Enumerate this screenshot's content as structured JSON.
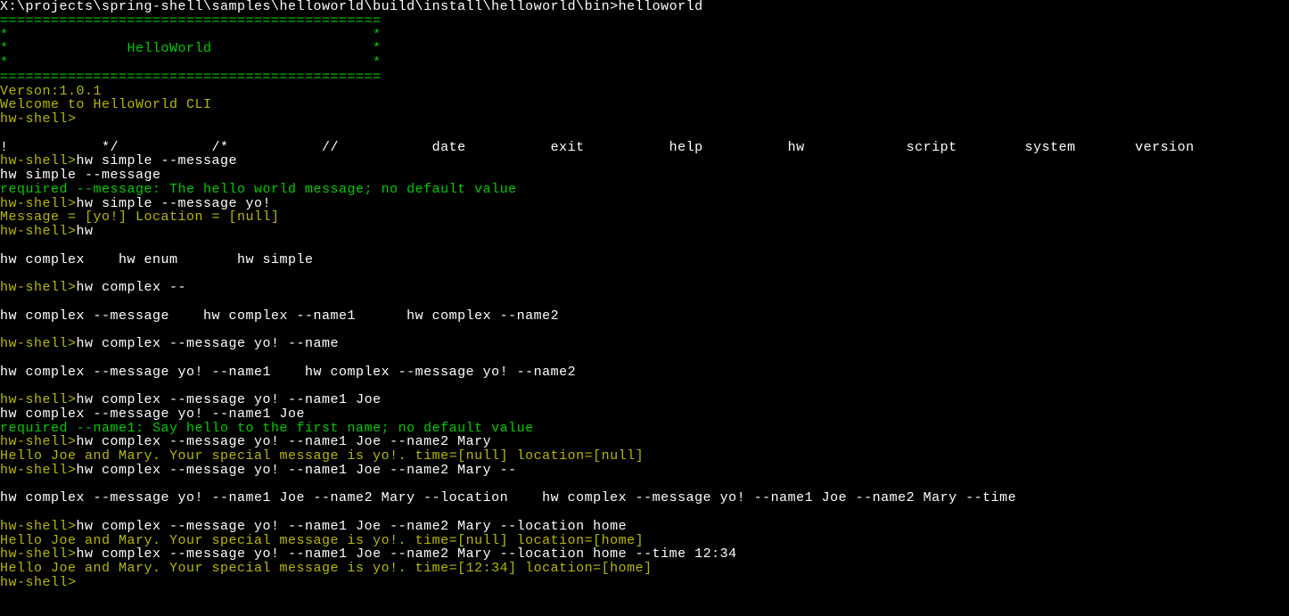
{
  "terminal": {
    "lines": [
      {
        "cls": "white",
        "text": "X:\\projects\\spring-shell\\samples\\helloworld\\build\\install\\helloworld\\bin>helloworld"
      },
      {
        "cls": "green",
        "text": "============================================="
      },
      {
        "cls": "green",
        "text": "*                                           *"
      },
      {
        "cls": "green",
        "text": "*              HelloWorld                   *"
      },
      {
        "cls": "green",
        "text": "*                                           *"
      },
      {
        "cls": "green",
        "text": "============================================="
      },
      {
        "cls": "yellow",
        "text": "Verson:1.0.1"
      },
      {
        "cls": "yellow",
        "text": "Welcome to HelloWorld CLI"
      },
      {
        "cls": "yellow",
        "text": "hw-shell>"
      },
      {
        "cls": "white",
        "text": ""
      },
      {
        "cls": "white",
        "text": "!           */           /*           //           date          exit          help          hw            script        system       version"
      },
      {
        "segments": [
          {
            "cls": "yellow",
            "text": "hw-shell>"
          },
          {
            "cls": "white",
            "text": "hw simple --message"
          }
        ]
      },
      {
        "cls": "white",
        "text": "hw simple --message"
      },
      {
        "cls": "green",
        "text": "required --message: The hello world message; no default value"
      },
      {
        "segments": [
          {
            "cls": "yellow",
            "text": "hw-shell>"
          },
          {
            "cls": "white",
            "text": "hw simple --message yo!"
          }
        ]
      },
      {
        "cls": "yellow",
        "text": "Message = [yo!] Location = [null]"
      },
      {
        "segments": [
          {
            "cls": "yellow",
            "text": "hw-shell>"
          },
          {
            "cls": "white",
            "text": "hw"
          }
        ]
      },
      {
        "cls": "white",
        "text": ""
      },
      {
        "cls": "white",
        "text": "hw complex    hw enum       hw simple"
      },
      {
        "cls": "white",
        "text": ""
      },
      {
        "segments": [
          {
            "cls": "yellow",
            "text": "hw-shell>"
          },
          {
            "cls": "white",
            "text": "hw complex --"
          }
        ]
      },
      {
        "cls": "white",
        "text": ""
      },
      {
        "cls": "white",
        "text": "hw complex --message    hw complex --name1      hw complex --name2"
      },
      {
        "cls": "white",
        "text": ""
      },
      {
        "segments": [
          {
            "cls": "yellow",
            "text": "hw-shell>"
          },
          {
            "cls": "white",
            "text": "hw complex --message yo! --name"
          }
        ]
      },
      {
        "cls": "white",
        "text": ""
      },
      {
        "cls": "white",
        "text": "hw complex --message yo! --name1    hw complex --message yo! --name2"
      },
      {
        "cls": "white",
        "text": ""
      },
      {
        "segments": [
          {
            "cls": "yellow",
            "text": "hw-shell>"
          },
          {
            "cls": "white",
            "text": "hw complex --message yo! --name1 Joe"
          }
        ]
      },
      {
        "cls": "white",
        "text": "hw complex --message yo! --name1 Joe"
      },
      {
        "cls": "green",
        "text": "required --name1: Say hello to the first name; no default value"
      },
      {
        "segments": [
          {
            "cls": "yellow",
            "text": "hw-shell>"
          },
          {
            "cls": "white",
            "text": "hw complex --message yo! --name1 Joe --name2 Mary"
          }
        ]
      },
      {
        "cls": "yellow",
        "text": "Hello Joe and Mary. Your special message is yo!. time=[null] location=[null]"
      },
      {
        "segments": [
          {
            "cls": "yellow",
            "text": "hw-shell>"
          },
          {
            "cls": "white",
            "text": "hw complex --message yo! --name1 Joe --name2 Mary --"
          }
        ]
      },
      {
        "cls": "white",
        "text": ""
      },
      {
        "cls": "white",
        "text": "hw complex --message yo! --name1 Joe --name2 Mary --location    hw complex --message yo! --name1 Joe --name2 Mary --time"
      },
      {
        "cls": "white",
        "text": ""
      },
      {
        "segments": [
          {
            "cls": "yellow",
            "text": "hw-shell>"
          },
          {
            "cls": "white",
            "text": "hw complex --message yo! --name1 Joe --name2 Mary --location home"
          }
        ]
      },
      {
        "cls": "yellow",
        "text": "Hello Joe and Mary. Your special message is yo!. time=[null] location=[home]"
      },
      {
        "segments": [
          {
            "cls": "yellow",
            "text": "hw-shell>"
          },
          {
            "cls": "white",
            "text": "hw complex --message yo! --name1 Joe --name2 Mary --location home --time 12:34"
          }
        ]
      },
      {
        "cls": "yellow",
        "text": "Hello Joe and Mary. Your special message is yo!. time=[12:34] location=[home]"
      },
      {
        "cls": "yellow",
        "text": "hw-shell>"
      }
    ]
  }
}
